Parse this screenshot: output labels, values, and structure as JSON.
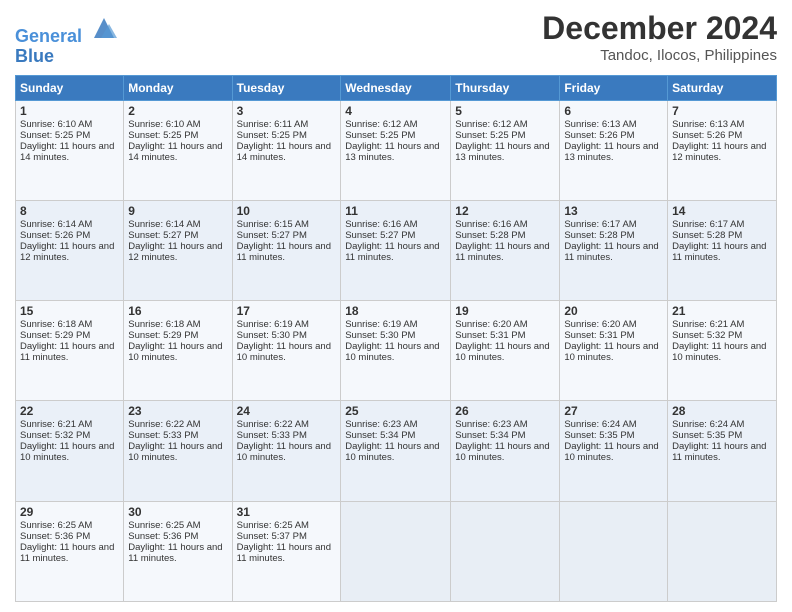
{
  "logo": {
    "line1": "General",
    "line2": "Blue"
  },
  "title": "December 2024",
  "location": "Tandoc, Ilocos, Philippines",
  "weekdays": [
    "Sunday",
    "Monday",
    "Tuesday",
    "Wednesday",
    "Thursday",
    "Friday",
    "Saturday"
  ],
  "weeks": [
    [
      {
        "day": 1,
        "info": "Sunrise: 6:10 AM\nSunset: 5:25 PM\nDaylight: 11 hours and 14 minutes."
      },
      {
        "day": 2,
        "info": "Sunrise: 6:10 AM\nSunset: 5:25 PM\nDaylight: 11 hours and 14 minutes."
      },
      {
        "day": 3,
        "info": "Sunrise: 6:11 AM\nSunset: 5:25 PM\nDaylight: 11 hours and 14 minutes."
      },
      {
        "day": 4,
        "info": "Sunrise: 6:12 AM\nSunset: 5:25 PM\nDaylight: 11 hours and 13 minutes."
      },
      {
        "day": 5,
        "info": "Sunrise: 6:12 AM\nSunset: 5:25 PM\nDaylight: 11 hours and 13 minutes."
      },
      {
        "day": 6,
        "info": "Sunrise: 6:13 AM\nSunset: 5:26 PM\nDaylight: 11 hours and 13 minutes."
      },
      {
        "day": 7,
        "info": "Sunrise: 6:13 AM\nSunset: 5:26 PM\nDaylight: 11 hours and 12 minutes."
      }
    ],
    [
      {
        "day": 8,
        "info": "Sunrise: 6:14 AM\nSunset: 5:26 PM\nDaylight: 11 hours and 12 minutes."
      },
      {
        "day": 9,
        "info": "Sunrise: 6:14 AM\nSunset: 5:27 PM\nDaylight: 11 hours and 12 minutes."
      },
      {
        "day": 10,
        "info": "Sunrise: 6:15 AM\nSunset: 5:27 PM\nDaylight: 11 hours and 11 minutes."
      },
      {
        "day": 11,
        "info": "Sunrise: 6:16 AM\nSunset: 5:27 PM\nDaylight: 11 hours and 11 minutes."
      },
      {
        "day": 12,
        "info": "Sunrise: 6:16 AM\nSunset: 5:28 PM\nDaylight: 11 hours and 11 minutes."
      },
      {
        "day": 13,
        "info": "Sunrise: 6:17 AM\nSunset: 5:28 PM\nDaylight: 11 hours and 11 minutes."
      },
      {
        "day": 14,
        "info": "Sunrise: 6:17 AM\nSunset: 5:28 PM\nDaylight: 11 hours and 11 minutes."
      }
    ],
    [
      {
        "day": 15,
        "info": "Sunrise: 6:18 AM\nSunset: 5:29 PM\nDaylight: 11 hours and 11 minutes."
      },
      {
        "day": 16,
        "info": "Sunrise: 6:18 AM\nSunset: 5:29 PM\nDaylight: 11 hours and 10 minutes."
      },
      {
        "day": 17,
        "info": "Sunrise: 6:19 AM\nSunset: 5:30 PM\nDaylight: 11 hours and 10 minutes."
      },
      {
        "day": 18,
        "info": "Sunrise: 6:19 AM\nSunset: 5:30 PM\nDaylight: 11 hours and 10 minutes."
      },
      {
        "day": 19,
        "info": "Sunrise: 6:20 AM\nSunset: 5:31 PM\nDaylight: 11 hours and 10 minutes."
      },
      {
        "day": 20,
        "info": "Sunrise: 6:20 AM\nSunset: 5:31 PM\nDaylight: 11 hours and 10 minutes."
      },
      {
        "day": 21,
        "info": "Sunrise: 6:21 AM\nSunset: 5:32 PM\nDaylight: 11 hours and 10 minutes."
      }
    ],
    [
      {
        "day": 22,
        "info": "Sunrise: 6:21 AM\nSunset: 5:32 PM\nDaylight: 11 hours and 10 minutes."
      },
      {
        "day": 23,
        "info": "Sunrise: 6:22 AM\nSunset: 5:33 PM\nDaylight: 11 hours and 10 minutes."
      },
      {
        "day": 24,
        "info": "Sunrise: 6:22 AM\nSunset: 5:33 PM\nDaylight: 11 hours and 10 minutes."
      },
      {
        "day": 25,
        "info": "Sunrise: 6:23 AM\nSunset: 5:34 PM\nDaylight: 11 hours and 10 minutes."
      },
      {
        "day": 26,
        "info": "Sunrise: 6:23 AM\nSunset: 5:34 PM\nDaylight: 11 hours and 10 minutes."
      },
      {
        "day": 27,
        "info": "Sunrise: 6:24 AM\nSunset: 5:35 PM\nDaylight: 11 hours and 10 minutes."
      },
      {
        "day": 28,
        "info": "Sunrise: 6:24 AM\nSunset: 5:35 PM\nDaylight: 11 hours and 11 minutes."
      }
    ],
    [
      {
        "day": 29,
        "info": "Sunrise: 6:25 AM\nSunset: 5:36 PM\nDaylight: 11 hours and 11 minutes."
      },
      {
        "day": 30,
        "info": "Sunrise: 6:25 AM\nSunset: 5:36 PM\nDaylight: 11 hours and 11 minutes."
      },
      {
        "day": 31,
        "info": "Sunrise: 6:25 AM\nSunset: 5:37 PM\nDaylight: 11 hours and 11 minutes."
      },
      null,
      null,
      null,
      null
    ]
  ]
}
